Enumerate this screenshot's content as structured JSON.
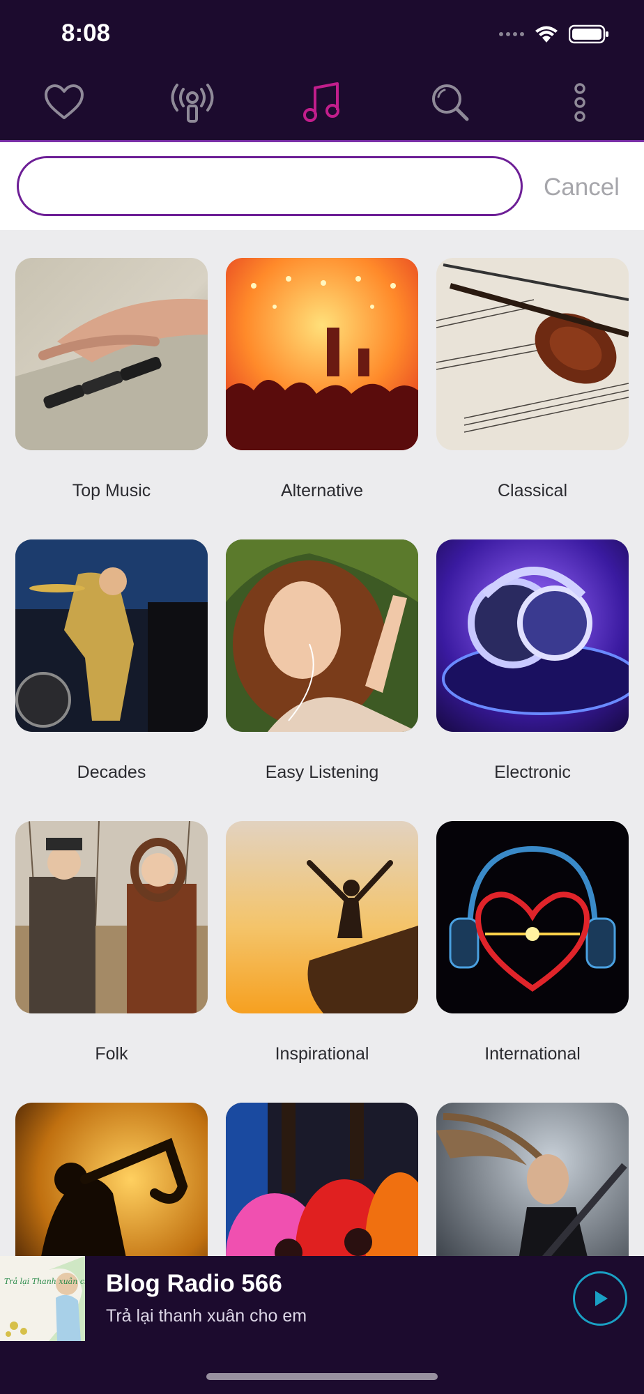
{
  "status_bar": {
    "time": "8:08"
  },
  "nav": {
    "items": [
      {
        "icon": "heart-icon",
        "active": false
      },
      {
        "icon": "radio-broadcast-icon",
        "active": false
      },
      {
        "icon": "music-note-icon",
        "active": true
      },
      {
        "icon": "search-icon",
        "active": false
      },
      {
        "icon": "more-vertical-icon",
        "active": false
      }
    ],
    "active_color": "#c21e8c",
    "inactive_color": "#8f8a98"
  },
  "search": {
    "value": "",
    "placeholder": "",
    "cancel_label": "Cancel"
  },
  "genres": [
    {
      "label": "Top Music"
    },
    {
      "label": "Alternative"
    },
    {
      "label": "Classical"
    },
    {
      "label": "Decades"
    },
    {
      "label": "Easy Listening"
    },
    {
      "label": "Electronic"
    },
    {
      "label": "Folk"
    },
    {
      "label": "Inspirational"
    },
    {
      "label": "International"
    },
    {
      "label": ""
    },
    {
      "label": ""
    },
    {
      "label": ""
    }
  ],
  "now_playing": {
    "title": "Blog Radio 566",
    "subtitle": "Trả lại thanh xuân cho em",
    "art_text": "Trả lại Thanh xuân cho em"
  },
  "colors": {
    "header_bg": "#1c0b2e",
    "accent": "#6d1f96",
    "play_accent": "#1aa0c4"
  }
}
